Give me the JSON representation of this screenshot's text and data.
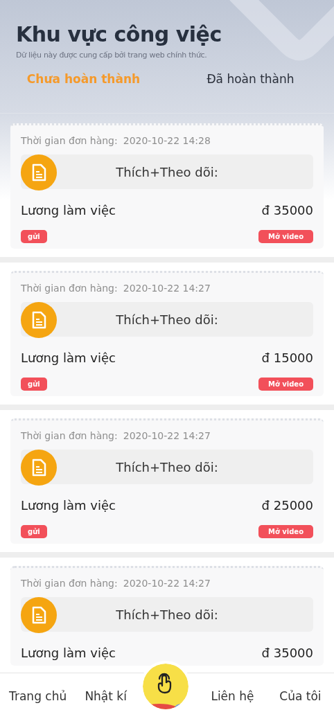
{
  "header": {
    "title": "Khu vực công việc",
    "subtitle": "Dữ liệu này được cung cấp bởi trang web chính thức."
  },
  "tabs": [
    {
      "label": "Chưa hoàn thành",
      "selected": true
    },
    {
      "label": "Đã hoàn thành",
      "selected": false
    }
  ],
  "orders": [
    {
      "time_label": "Thời gian đơn hàng:",
      "time": "2020-10-22 14:28",
      "task": "Thích+Theo dõi:",
      "salary_label": "Lương làm việc",
      "salary": "đ 35000",
      "buttons": [
        "gửi",
        "Mở video"
      ]
    },
    {
      "time_label": "Thời gian đơn hàng:",
      "time": "2020-10-22 14:27",
      "task": "Thích+Theo dõi:",
      "salary_label": "Lương làm việc",
      "salary": "đ 15000",
      "buttons": [
        "gửi",
        "Mở video"
      ]
    },
    {
      "time_label": "Thời gian đơn hàng:",
      "time": "2020-10-22 14:27",
      "task": "Thích+Theo dõi:",
      "salary_label": "Lương làm việc",
      "salary": "đ 25000",
      "buttons": [
        "gửi",
        "Mở video"
      ]
    },
    {
      "time_label": "Thời gian đơn hàng:",
      "time": "2020-10-22 14:27",
      "task": "Thích+Theo dõi:",
      "salary_label": "Lương làm việc",
      "salary": "đ 35000"
    }
  ],
  "nav": [
    {
      "label": "Trang chủ"
    },
    {
      "label": "Nhật kí"
    },
    {
      "label": "Liên hệ"
    },
    {
      "label": "Của tôi"
    }
  ]
}
